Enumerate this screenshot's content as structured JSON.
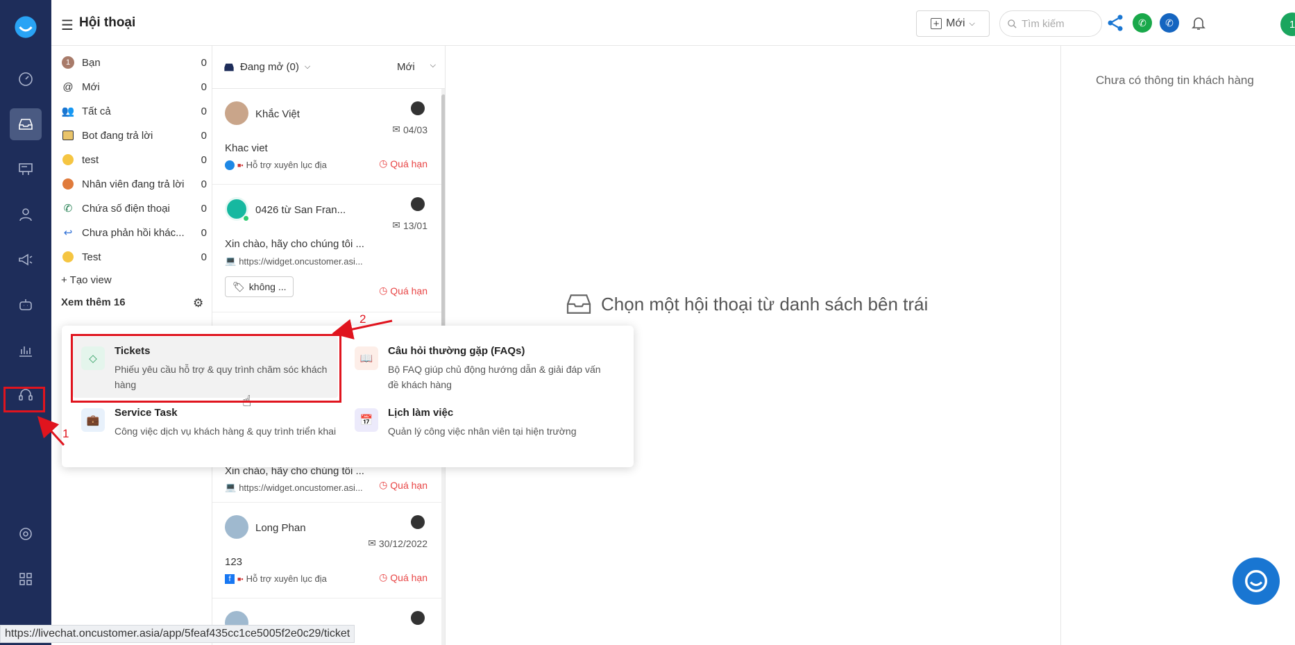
{
  "header": {
    "title": "Hội thoại",
    "new_button_label": "Mới",
    "search_placeholder": "Tìm kiếm",
    "avatar_text": "1"
  },
  "views": {
    "items": [
      {
        "label": "Bạn",
        "count": "0",
        "icon": "user-badge-icon"
      },
      {
        "label": "Mới",
        "count": "0",
        "icon": "at-icon"
      },
      {
        "label": "Tất cả",
        "count": "0",
        "icon": "users-icon"
      },
      {
        "label": "Bot đang trả lời",
        "count": "0",
        "icon": "robot-icon"
      },
      {
        "label": "test",
        "count": "0",
        "icon": "smile-icon"
      },
      {
        "label": "Nhân viên đang trả lời",
        "count": "0",
        "icon": "agent-icon"
      },
      {
        "label": "Chứa số điện thoại",
        "count": "0",
        "icon": "phone-icon"
      },
      {
        "label": "Chưa phản hồi khác...",
        "count": "0",
        "icon": "reply-icon"
      },
      {
        "label": "Test",
        "count": "0",
        "icon": "smile-icon"
      }
    ],
    "create_view": "+ Tạo view",
    "see_more": "Xem thêm 16"
  },
  "conversations": {
    "open_filter": "Đang mở (0)",
    "sort_filter": "Mới",
    "items": [
      {
        "name": "Khắc Việt",
        "date": "04/03",
        "message": "Khac viet",
        "source": "Hỗ trợ xuyên lục địa",
        "due": "Quá hạn"
      },
      {
        "name": "0426 từ San Fran...",
        "date": "13/01",
        "message": "Xin chào, hãy cho chúng tôi ...",
        "source": "https://widget.oncustomer.asi...",
        "tag": "không ...",
        "due": "Quá hạn"
      },
      {
        "message": "Xin chào, hãy cho chúng tôi ...",
        "source": "https://widget.oncustomer.asi...",
        "due": "Quá hạn"
      },
      {
        "name": "Long Phan",
        "date": "30/12/2022",
        "message": "123",
        "source": "Hỗ trợ xuyên lục địa",
        "due": "Quá hạn"
      }
    ]
  },
  "center": {
    "empty_message": "Chọn một hội thoại từ danh sách bên trái"
  },
  "right_panel": {
    "no_info": "Chưa có thông tin khách hàng"
  },
  "popup": {
    "items": [
      {
        "title": "Tickets",
        "desc": "Phiếu yêu cầu hỗ trợ & quy trình chăm sóc khách hàng"
      },
      {
        "title": "Câu hỏi thường gặp (FAQs)",
        "desc": "Bộ FAQ giúp chủ động hướng dẫn & giải đáp vấn đề khách hàng"
      },
      {
        "title": "Service Task",
        "desc": "Công việc dịch vụ khách hàng & quy trình triển khai"
      },
      {
        "title": "Lịch làm việc",
        "desc": "Quản lý công việc nhân viên tại hiện trường"
      }
    ]
  },
  "annotations": {
    "step1": "1",
    "step2": "2"
  },
  "status_url": "https://livechat.oncustomer.asia/app/5feaf435cc1ce5005f2e0c29/ticket",
  "colors": {
    "rail": "#1e2d5a",
    "accent": "#1976d2",
    "overdue": "#e84545",
    "annotation": "#e0141e"
  }
}
